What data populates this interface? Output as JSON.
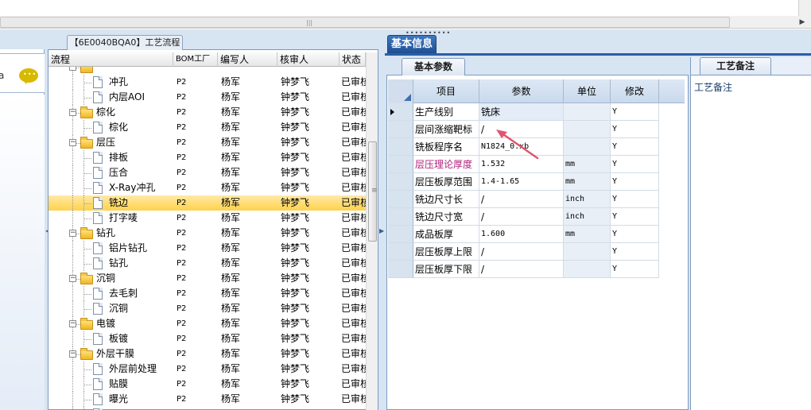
{
  "tree_panel": {
    "tab_title": "【6E0040BQA0】工艺流程",
    "columns": [
      "流程",
      "BOM工厂",
      "编写人",
      "核审人",
      "状态"
    ],
    "rows": [
      {
        "type": "folder",
        "label": "",
        "bom": "",
        "writer": "",
        "reviewer": "",
        "status": "",
        "partial": true
      },
      {
        "type": "doc",
        "label": "冲孔",
        "bom": "P2",
        "writer": "杨军",
        "reviewer": "钟梦飞",
        "status": "已审核"
      },
      {
        "type": "doc",
        "label": "内层AOI",
        "bom": "P2",
        "writer": "杨军",
        "reviewer": "钟梦飞",
        "status": "已审核"
      },
      {
        "type": "folder",
        "label": "棕化",
        "bom": "P2",
        "writer": "杨军",
        "reviewer": "钟梦飞",
        "status": "已审核"
      },
      {
        "type": "doc",
        "label": "棕化",
        "bom": "P2",
        "writer": "杨军",
        "reviewer": "钟梦飞",
        "status": "已审核"
      },
      {
        "type": "folder",
        "label": "层压",
        "bom": "P2",
        "writer": "杨军",
        "reviewer": "钟梦飞",
        "status": "已审核"
      },
      {
        "type": "doc",
        "label": "排板",
        "bom": "P2",
        "writer": "杨军",
        "reviewer": "钟梦飞",
        "status": "已审核"
      },
      {
        "type": "doc",
        "label": "压合",
        "bom": "P2",
        "writer": "杨军",
        "reviewer": "钟梦飞",
        "status": "已审核"
      },
      {
        "type": "doc",
        "label": "X-Ray冲孔",
        "bom": "P2",
        "writer": "杨军",
        "reviewer": "钟梦飞",
        "status": "已审核"
      },
      {
        "type": "doc",
        "label": "铣边",
        "bom": "P2",
        "writer": "杨军",
        "reviewer": "钟梦飞",
        "status": "已审核",
        "selected": true
      },
      {
        "type": "doc",
        "label": "打字唛",
        "bom": "P2",
        "writer": "杨军",
        "reviewer": "钟梦飞",
        "status": "已审核"
      },
      {
        "type": "folder",
        "label": "钻孔",
        "bom": "P2",
        "writer": "杨军",
        "reviewer": "钟梦飞",
        "status": "已审核"
      },
      {
        "type": "doc",
        "label": "铝片钻孔",
        "bom": "P2",
        "writer": "杨军",
        "reviewer": "钟梦飞",
        "status": "已审核"
      },
      {
        "type": "doc",
        "label": "钻孔",
        "bom": "P2",
        "writer": "杨军",
        "reviewer": "钟梦飞",
        "status": "已审核"
      },
      {
        "type": "folder",
        "label": "沉铜",
        "bom": "P2",
        "writer": "杨军",
        "reviewer": "钟梦飞",
        "status": "已审核"
      },
      {
        "type": "doc",
        "label": "去毛刺",
        "bom": "P2",
        "writer": "杨军",
        "reviewer": "钟梦飞",
        "status": "已审核"
      },
      {
        "type": "doc",
        "label": "沉铜",
        "bom": "P2",
        "writer": "杨军",
        "reviewer": "钟梦飞",
        "status": "已审核"
      },
      {
        "type": "folder",
        "label": "电镀",
        "bom": "P2",
        "writer": "杨军",
        "reviewer": "钟梦飞",
        "status": "已审核"
      },
      {
        "type": "doc",
        "label": "板镀",
        "bom": "P2",
        "writer": "杨军",
        "reviewer": "钟梦飞",
        "status": "已审核"
      },
      {
        "type": "folder",
        "label": "外层干膜",
        "bom": "P2",
        "writer": "杨军",
        "reviewer": "钟梦飞",
        "status": "已审核"
      },
      {
        "type": "doc",
        "label": "外层前处理",
        "bom": "P2",
        "writer": "杨军",
        "reviewer": "钟梦飞",
        "status": "已审核"
      },
      {
        "type": "doc",
        "label": "贴膜",
        "bom": "P2",
        "writer": "杨军",
        "reviewer": "钟梦飞",
        "status": "已审核"
      },
      {
        "type": "doc",
        "label": "曝光",
        "bom": "P2",
        "writer": "杨军",
        "reviewer": "钟梦飞",
        "status": "已审核"
      },
      {
        "type": "doc",
        "label": "",
        "bom": "",
        "writer": "",
        "reviewer": "",
        "status": "",
        "partial": true
      }
    ]
  },
  "basic_info": {
    "tab_label": "基本信息",
    "sub_tab_label": "基本参数",
    "columns": [
      "项目",
      "参数",
      "单位",
      "修改"
    ],
    "rows": [
      {
        "item": "生产线别",
        "param": "铣床",
        "unit": "",
        "modify": "Y",
        "current": true
      },
      {
        "item": "层间涨缩靶标",
        "param": "/",
        "unit": "",
        "modify": "Y"
      },
      {
        "item": "铣板程序名",
        "param": "N1824_0.xb",
        "unit": "",
        "modify": "Y"
      },
      {
        "item": "层压理论厚度",
        "param": "1.532",
        "unit": "mm",
        "modify": "Y",
        "highlight": true
      },
      {
        "item": "层压板厚范围",
        "param": "1.4-1.65",
        "unit": "mm",
        "modify": "Y"
      },
      {
        "item": "铣边尺寸长",
        "param": "/",
        "unit": "inch",
        "modify": "Y"
      },
      {
        "item": "铣边尺寸宽",
        "param": "/",
        "unit": "inch",
        "modify": "Y"
      },
      {
        "item": "成品板厚",
        "param": "1.600",
        "unit": "mm",
        "modify": "Y"
      },
      {
        "item": "层压板厚上限",
        "param": "/",
        "unit": "",
        "modify": "Y"
      },
      {
        "item": "层压板厚下限",
        "param": "/",
        "unit": "",
        "modify": "Y"
      }
    ],
    "highlight_color": "#b0207a",
    "arrow_color": "#e0566e"
  },
  "notes": {
    "tab_label": "工艺备注",
    "field_label": "工艺备注"
  }
}
